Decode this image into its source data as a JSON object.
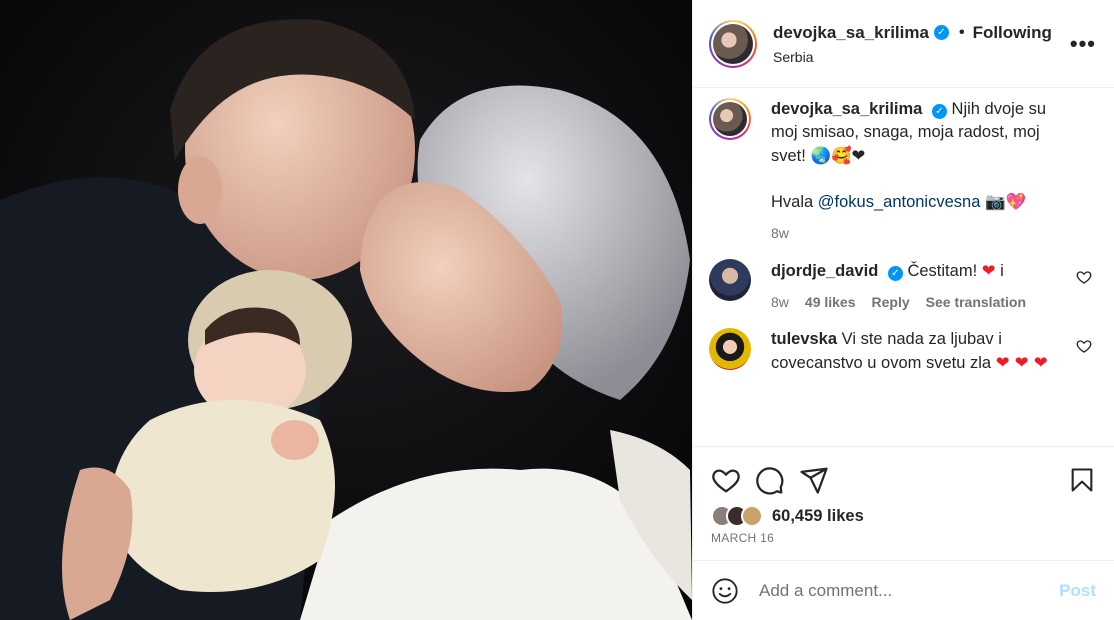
{
  "header": {
    "username": "devojka_sa_krilima",
    "separator": "•",
    "following_label": "Following",
    "location": "Serbia",
    "more_label": "•••"
  },
  "caption": {
    "username": "devojka_sa_krilima",
    "text": "Njih dvoje su moj smisao, snaga, moja radost, moj svet!",
    "emojis": "🌏🥰❤",
    "thanks_prefix": "Hvala",
    "mention": "@fokus_antonicvesna",
    "thanks_emojis": "📷💖",
    "time": "8w"
  },
  "comments": [
    {
      "username": "djordje_david",
      "verified": true,
      "text": "Čestitam!",
      "emoji": "❤",
      "suffix": "i",
      "time": "8w",
      "likes": "49 likes",
      "reply_label": "Reply",
      "translate_label": "See translation"
    },
    {
      "username": "tulevska",
      "verified": false,
      "text": "Vi ste nada za ljubav i covecanstvo u ovom svetu zla",
      "emoji": "❤ ❤ ❤"
    }
  ],
  "actions": {
    "likes": "60,459 likes",
    "date": "MARCH 16",
    "like_icon": "heart-icon",
    "comment_icon": "comment-icon",
    "share_icon": "share-icon",
    "save_icon": "bookmark-icon"
  },
  "add_comment": {
    "placeholder": "Add a comment...",
    "post_label": "Post",
    "emoji_icon": "smiley-icon"
  },
  "colors": {
    "verified": "#0095f6",
    "link": "#00376b",
    "post_disabled": "#b2dffc",
    "meta": "#737373"
  }
}
